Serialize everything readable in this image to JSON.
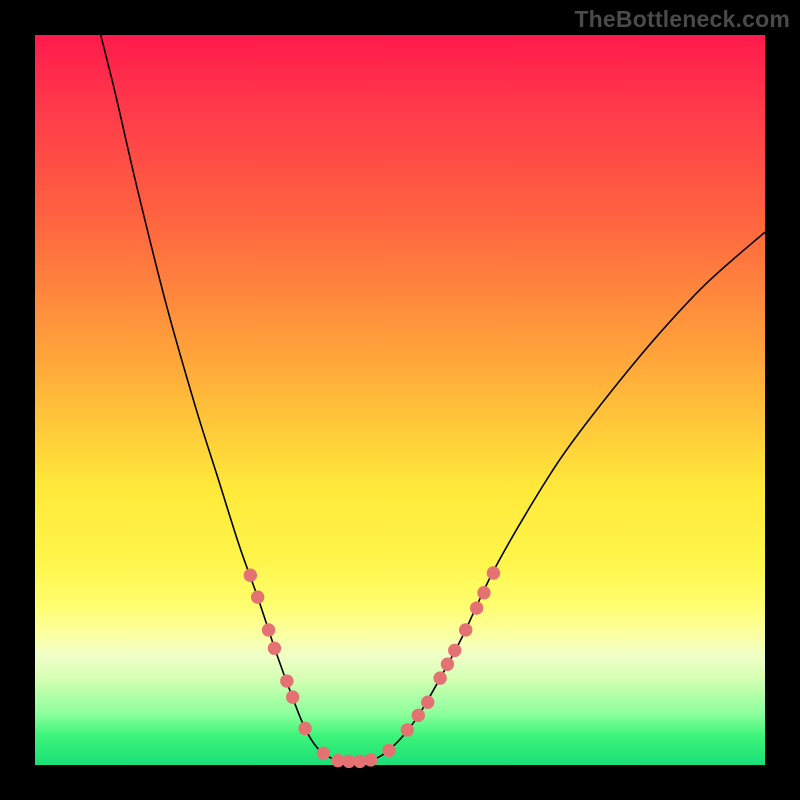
{
  "watermark": "TheBottleneck.com",
  "chart_data": {
    "type": "line",
    "title": "",
    "xlabel": "",
    "ylabel": "",
    "xlim": [
      0,
      100
    ],
    "ylim": [
      0,
      100
    ],
    "grid": false,
    "legend": false,
    "curve_points": [
      {
        "x": 9.0,
        "y": 100.0
      },
      {
        "x": 11.0,
        "y": 92.0
      },
      {
        "x": 14.0,
        "y": 79.0
      },
      {
        "x": 18.0,
        "y": 63.0
      },
      {
        "x": 22.0,
        "y": 49.0
      },
      {
        "x": 25.0,
        "y": 39.5
      },
      {
        "x": 28.0,
        "y": 30.0
      },
      {
        "x": 30.5,
        "y": 23.0
      },
      {
        "x": 33.0,
        "y": 15.5
      },
      {
        "x": 35.0,
        "y": 10.0
      },
      {
        "x": 37.0,
        "y": 5.0
      },
      {
        "x": 39.0,
        "y": 2.0
      },
      {
        "x": 41.5,
        "y": 0.6
      },
      {
        "x": 44.0,
        "y": 0.5
      },
      {
        "x": 46.5,
        "y": 0.8
      },
      {
        "x": 49.0,
        "y": 2.5
      },
      {
        "x": 52.0,
        "y": 6.0
      },
      {
        "x": 55.0,
        "y": 11.0
      },
      {
        "x": 58.5,
        "y": 17.5
      },
      {
        "x": 62.5,
        "y": 26.0
      },
      {
        "x": 67.0,
        "y": 34.0
      },
      {
        "x": 72.0,
        "y": 42.0
      },
      {
        "x": 78.0,
        "y": 50.0
      },
      {
        "x": 85.0,
        "y": 58.5
      },
      {
        "x": 92.0,
        "y": 66.0
      },
      {
        "x": 100.0,
        "y": 73.0
      }
    ],
    "points": [
      {
        "x": 29.5,
        "y": 26.0
      },
      {
        "x": 30.5,
        "y": 23.0
      },
      {
        "x": 32.0,
        "y": 18.5
      },
      {
        "x": 32.8,
        "y": 16.0
      },
      {
        "x": 34.5,
        "y": 11.5
      },
      {
        "x": 35.3,
        "y": 9.3
      },
      {
        "x": 37.0,
        "y": 5.0
      },
      {
        "x": 39.5,
        "y": 1.6
      },
      {
        "x": 41.5,
        "y": 0.6
      },
      {
        "x": 43.0,
        "y": 0.5
      },
      {
        "x": 44.5,
        "y": 0.5
      },
      {
        "x": 46.0,
        "y": 0.7
      },
      {
        "x": 48.5,
        "y": 2.0
      },
      {
        "x": 51.0,
        "y": 4.8
      },
      {
        "x": 52.5,
        "y": 6.8
      },
      {
        "x": 53.8,
        "y": 8.6
      },
      {
        "x": 55.5,
        "y": 11.9
      },
      {
        "x": 56.5,
        "y": 13.8
      },
      {
        "x": 57.5,
        "y": 15.7
      },
      {
        "x": 59.0,
        "y": 18.5
      },
      {
        "x": 60.5,
        "y": 21.5
      },
      {
        "x": 61.5,
        "y": 23.6
      },
      {
        "x": 62.8,
        "y": 26.3
      }
    ]
  }
}
